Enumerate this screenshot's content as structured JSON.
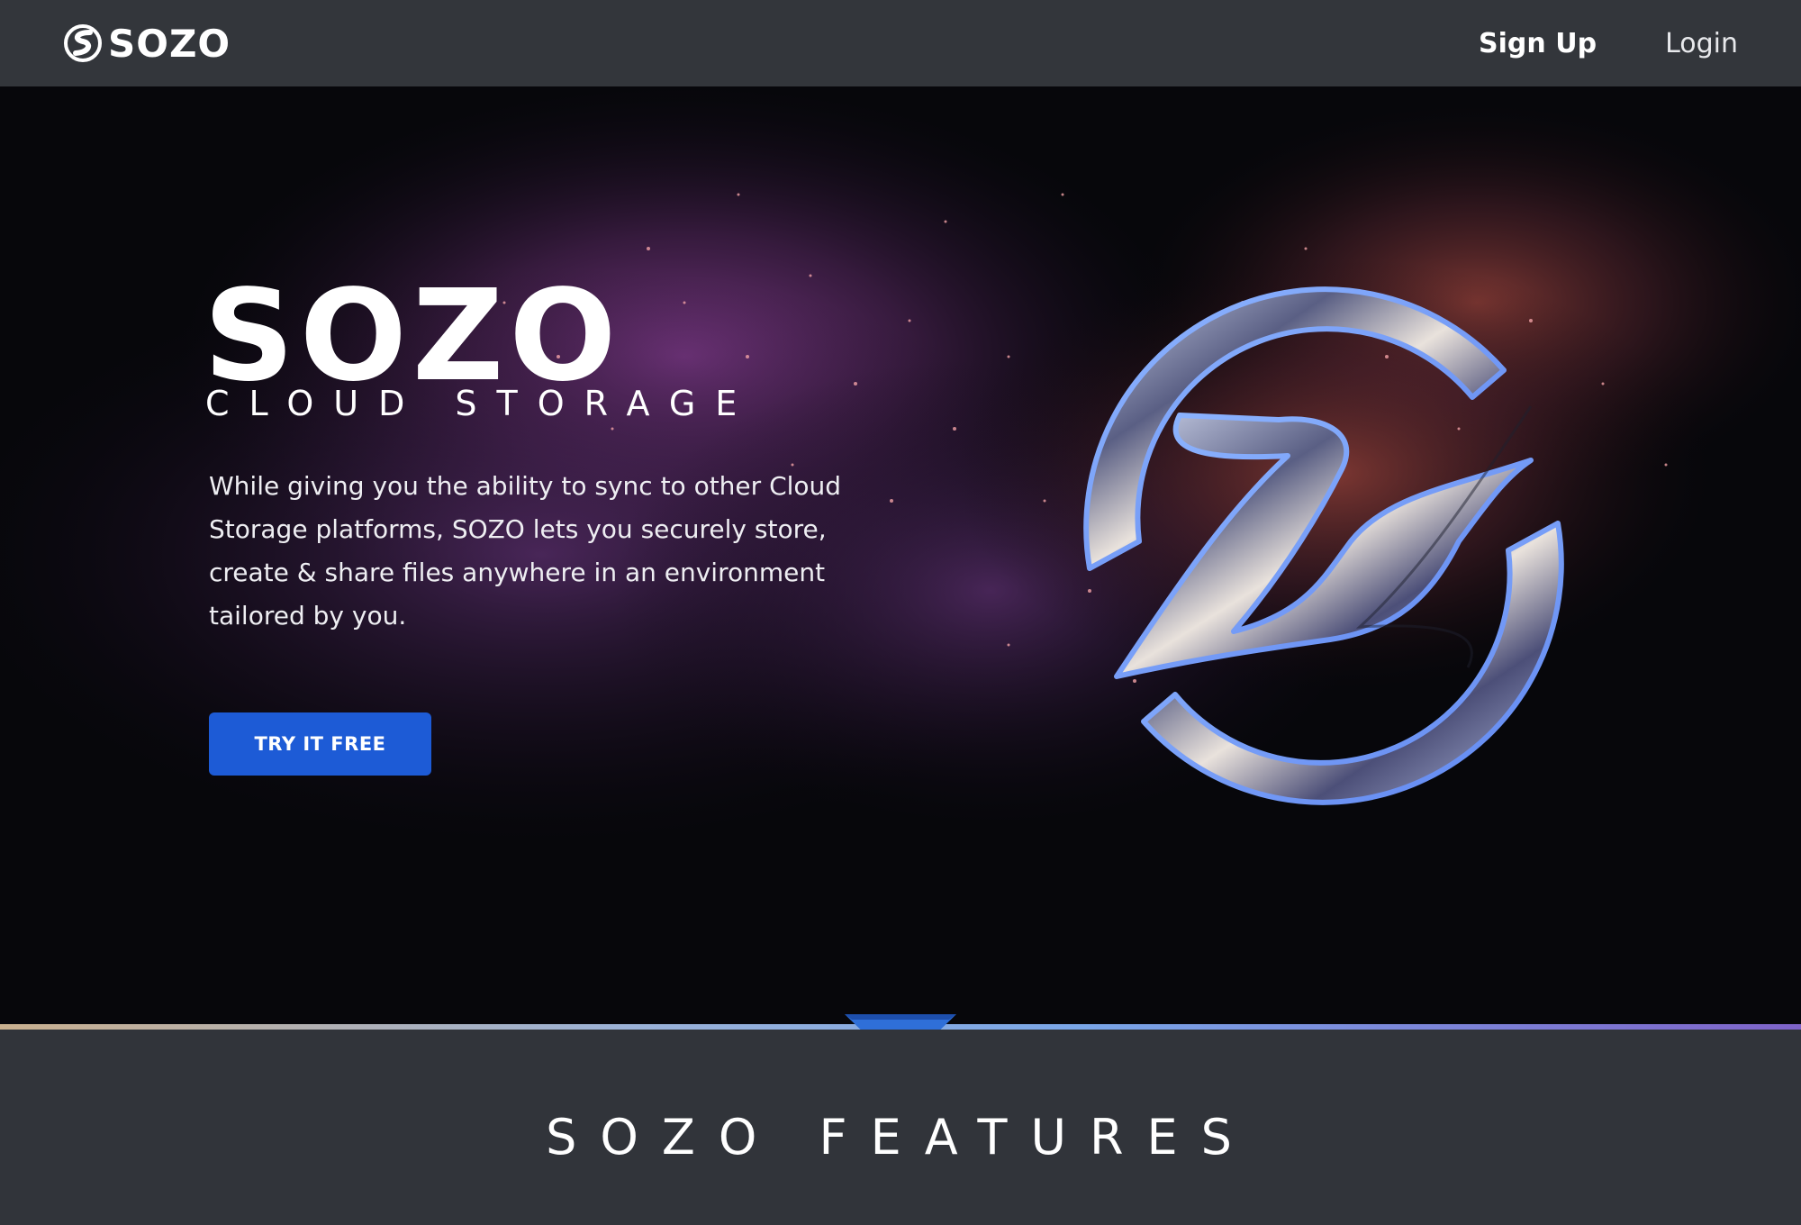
{
  "header": {
    "brand": "SOZO",
    "nav": {
      "signup_label": "Sign Up",
      "login_label": "Login"
    }
  },
  "hero": {
    "title": "SOZO",
    "subtitle": "CLOUD STORAGE",
    "description": "While giving you the ability to sync to other Cloud Storage platforms, SOZO lets you securely store, create & share files anywhere in an environment tailored by you.",
    "cta_label": "TRY IT FREE",
    "emblem_icon": "sozo-s-emblem-icon"
  },
  "divider": {
    "arrow_icon": "chevron-down-arrow-icon",
    "accent_colors": [
      "#c9b08f",
      "#7aa6e8",
      "#7e63c9"
    ]
  },
  "features": {
    "title": "SOZO FEATURES"
  },
  "colors": {
    "header_bg": "#33363b",
    "hero_bg": "#07070b",
    "cta": "#1d5bd6",
    "features_bg": "#31343a"
  }
}
